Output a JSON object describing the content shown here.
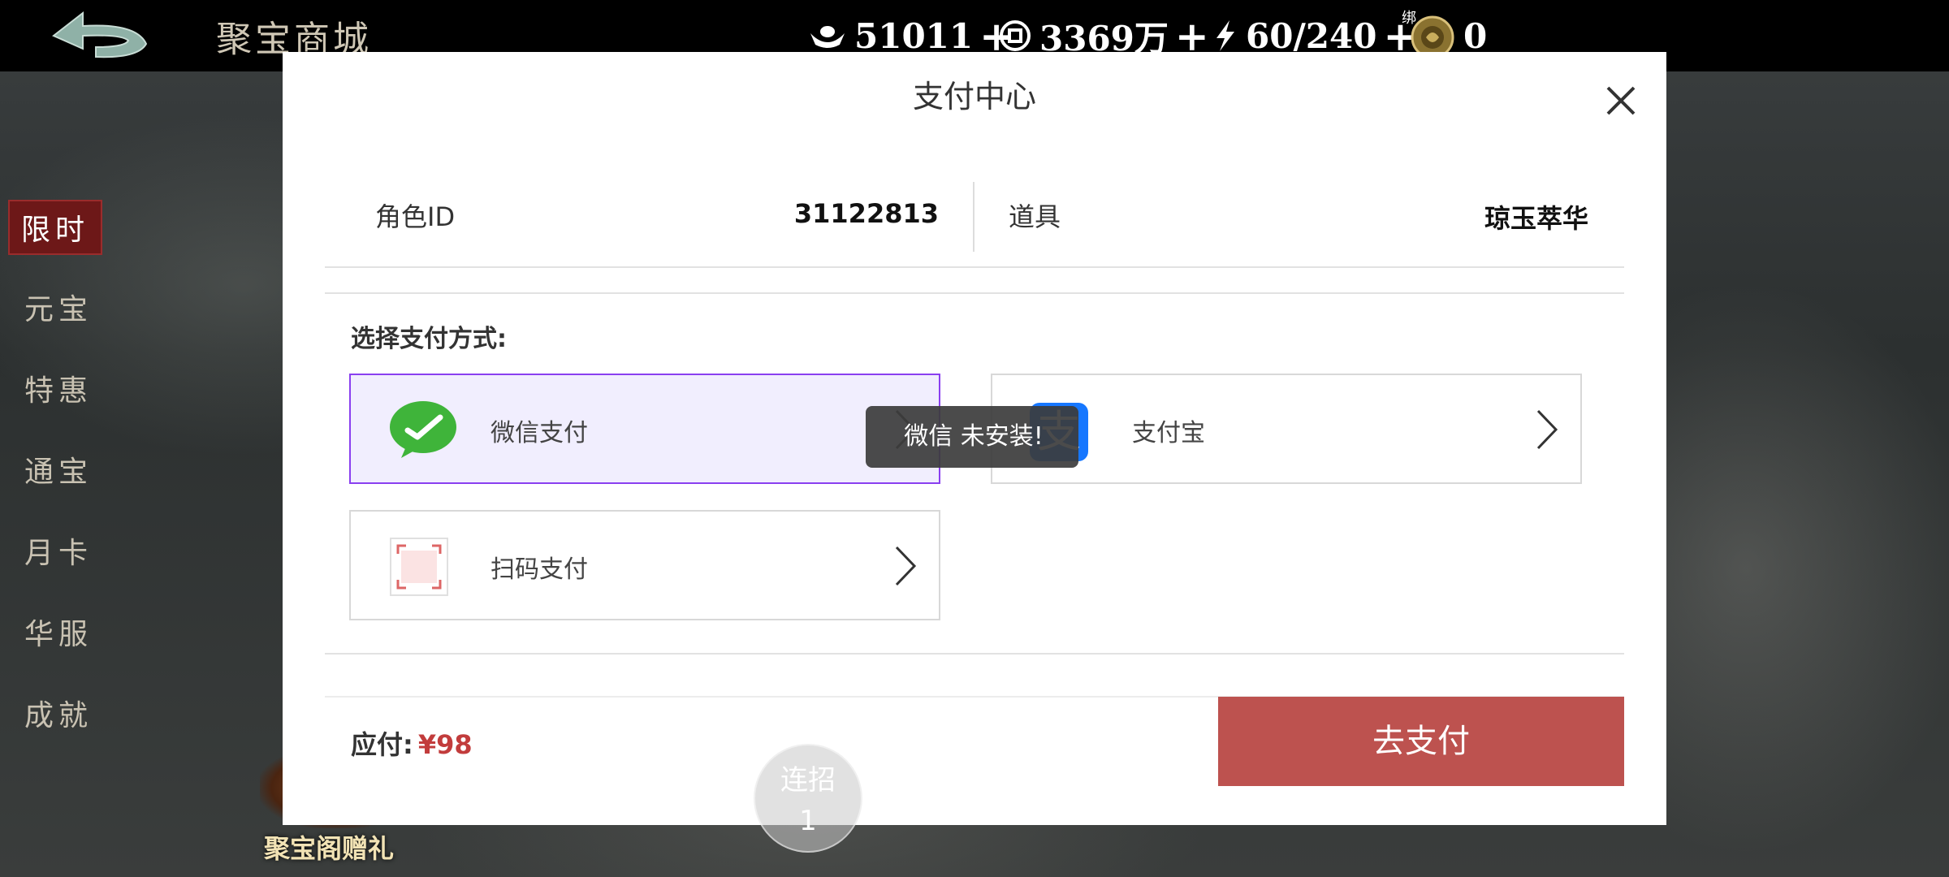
{
  "header": {
    "title": "聚宝商城",
    "resources": [
      {
        "icon": "ingot-icon",
        "value": "51011"
      },
      {
        "icon": "coin-icon",
        "value": "3369万"
      },
      {
        "icon": "energy-icon",
        "value": "60/240"
      },
      {
        "icon": "bound-coin-icon",
        "value": "0",
        "badge": "绑"
      }
    ],
    "plus": "+"
  },
  "side_menu": [
    "限时",
    "元宝",
    "特惠",
    "通宝",
    "月卡",
    "华服",
    "成就"
  ],
  "gift_label": "聚宝阁赠礼",
  "dialog": {
    "title": "支付中心",
    "role_label": "角色ID",
    "role_value": "31122813",
    "item_label": "道具",
    "item_value": "琼玉萃华",
    "select_method": "选择支付方式:",
    "methods": [
      {
        "label": "微信支付",
        "icon": "wechat-icon",
        "selected": true
      },
      {
        "label": "支付宝",
        "icon": "alipay-icon",
        "selected": false
      },
      {
        "label": "扫码支付",
        "icon": "qr-scan-icon",
        "selected": false
      }
    ],
    "toast": "微信 未安装!",
    "amount_label": "应付:",
    "amount_value": "¥98",
    "pay_button": "去支付"
  },
  "combo_button": {
    "label": "连招",
    "count": "1"
  },
  "colors": {
    "accent_red": "#bd524f",
    "price_red": "#c23c3c",
    "selected_border": "#8a3ff0",
    "wechat_green": "#3fb43a",
    "alipay_blue": "#1677ff"
  }
}
